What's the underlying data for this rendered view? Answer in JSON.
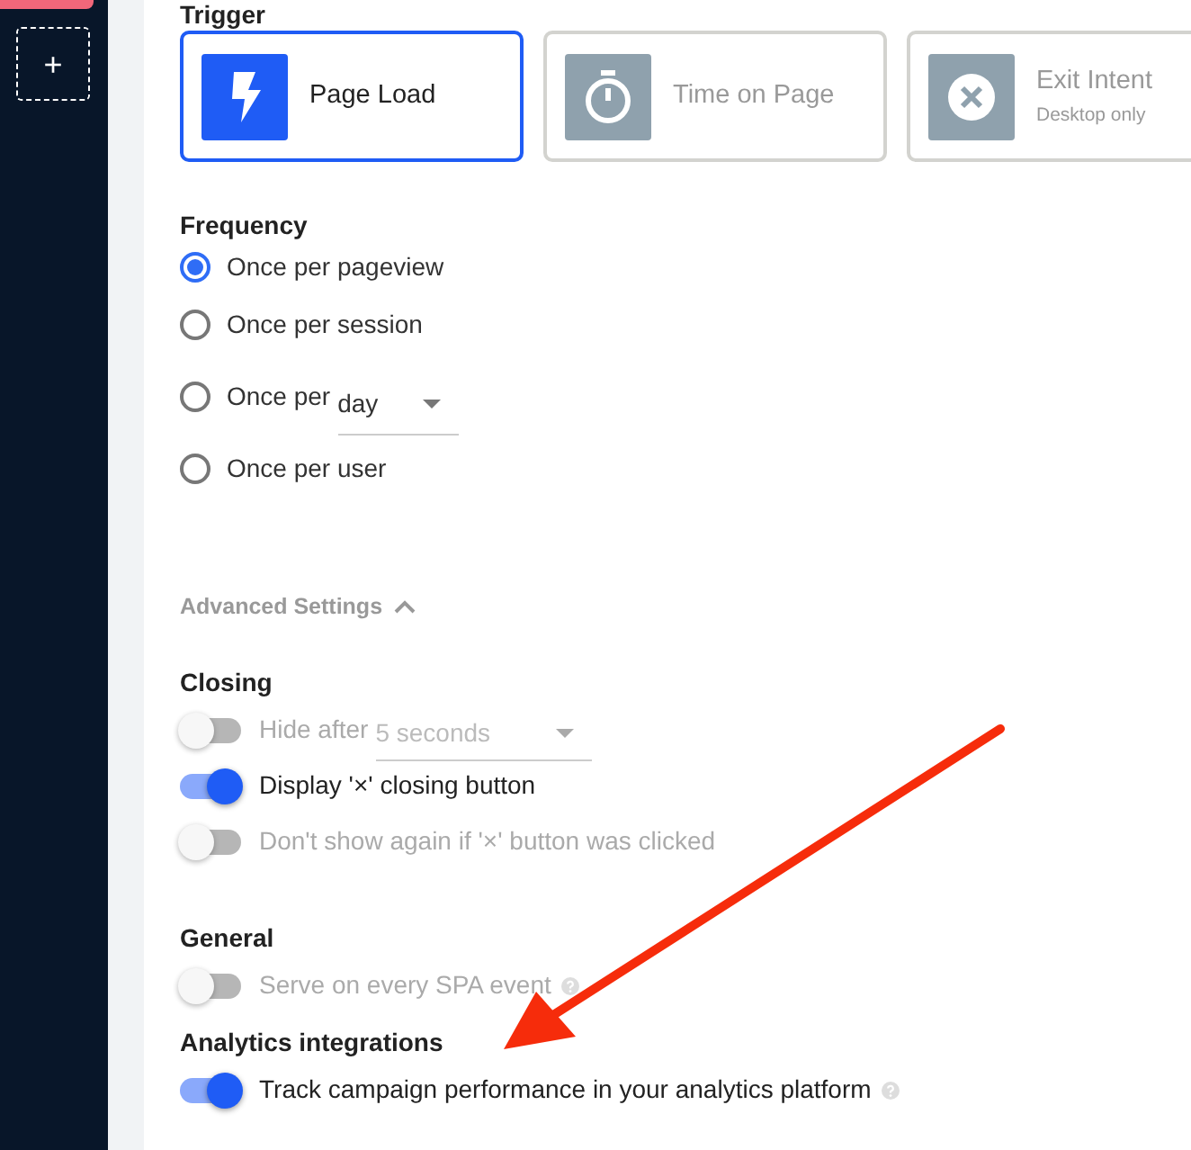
{
  "sidebar": {
    "add_button": "+"
  },
  "trigger": {
    "heading": "Trigger",
    "options": [
      {
        "kind": "page_load",
        "label": "Page Load",
        "selected": true
      },
      {
        "kind": "timer",
        "label": "Time on Page",
        "selected": false
      },
      {
        "kind": "exit",
        "label": "Exit Intent",
        "subtitle": "Desktop only",
        "selected": false
      }
    ]
  },
  "frequency": {
    "heading": "Frequency",
    "options": [
      {
        "label": "Once per pageview",
        "selected": true
      },
      {
        "label": "Once per session",
        "selected": false
      },
      {
        "label": "Once per",
        "selected": false,
        "select": "day"
      },
      {
        "label": "Once per user",
        "selected": false
      }
    ]
  },
  "advanced": {
    "label": "Advanced Settings",
    "expanded": true
  },
  "sections": [
    {
      "heading": "Closing",
      "toggles": [
        {
          "label": "Hide after",
          "on": false,
          "disabled": true,
          "select": "5 seconds"
        },
        {
          "label": "Display '×' closing button",
          "on": true,
          "disabled": false
        },
        {
          "label": "Don't show again if '×' button was clicked",
          "on": false,
          "disabled": true
        }
      ]
    },
    {
      "heading": "General",
      "toggles": [
        {
          "label": "Serve on every SPA event",
          "on": false,
          "disabled": true,
          "help": true
        }
      ]
    },
    {
      "heading": "Analytics integrations",
      "toggles": [
        {
          "label": "Track campaign performance in your analytics platform",
          "on": true,
          "disabled": false,
          "help": true
        }
      ]
    }
  ]
}
